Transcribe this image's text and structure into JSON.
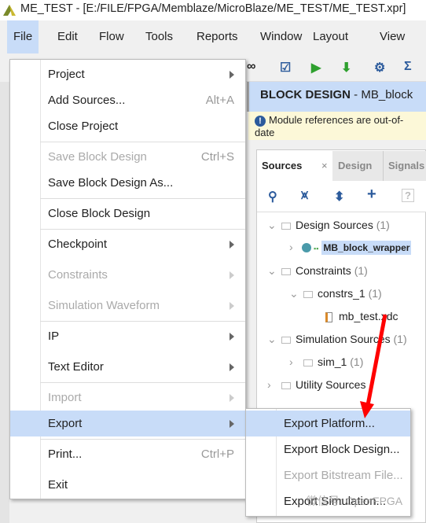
{
  "window": {
    "title": "ME_TEST - [E:/FILE/FPGA/Memblaze/MicroBlaze/ME_TEST/ME_TEST.xpr]"
  },
  "menubar": [
    "File",
    "Edit",
    "Flow",
    "Tools",
    "Reports",
    "Window",
    "Layout",
    "View"
  ],
  "block_design": {
    "title": "BLOCK DESIGN",
    "name": " - MB_block"
  },
  "notice": "Module references are out-of-date",
  "tabs": [
    "Sources",
    "Design",
    "Signals"
  ],
  "tree": {
    "design_sources": "Design Sources",
    "design_sources_count": "(1)",
    "wrapper": "MB_block_wrapper",
    "constraints": "Constraints",
    "constraints_count": "(1)",
    "constrs": "constrs_1",
    "constrs_count": "(1)",
    "xdc": "mb_test.xdc",
    "sim_sources": "Simulation Sources",
    "sim_sources_count": "(1)",
    "sim": "sim_1",
    "sim_count": "(1)",
    "utility": "Utility Sources"
  },
  "file_menu": [
    {
      "label": "Project",
      "submenu": true
    },
    {
      "label": "Add Sources...",
      "shortcut": "Alt+A"
    },
    {
      "label": "Close Project"
    },
    {
      "label": "Save Block Design",
      "shortcut": "Ctrl+S",
      "disabled": true
    },
    {
      "label": "Save Block Design As..."
    },
    {
      "label": "Close Block Design"
    },
    {
      "label": "Checkpoint",
      "submenu": true
    },
    {
      "label": "Constraints",
      "submenu": true,
      "disabled": true
    },
    {
      "label": "Simulation Waveform",
      "submenu": true,
      "disabled": true
    },
    {
      "label": "IP",
      "submenu": true
    },
    {
      "label": "Text Editor",
      "submenu": true
    },
    {
      "label": "Import",
      "submenu": true,
      "disabled": true
    },
    {
      "label": "Export",
      "submenu": true,
      "highlighted": true
    },
    {
      "label": "Print...",
      "shortcut": "Ctrl+P"
    },
    {
      "label": "Exit"
    }
  ],
  "export_menu": [
    {
      "label": "Export Platform...",
      "highlighted": true
    },
    {
      "label": "Export Block Design..."
    },
    {
      "label": "Export Bitstream File...",
      "disabled": true
    },
    {
      "label": "Export Simulation..."
    }
  ],
  "watermark": "微信号: OpenFPGA",
  "colors": {
    "highlight": "#c8dcf8",
    "arrow": "#ff0000",
    "notice_bg": "#fcf8d8"
  }
}
